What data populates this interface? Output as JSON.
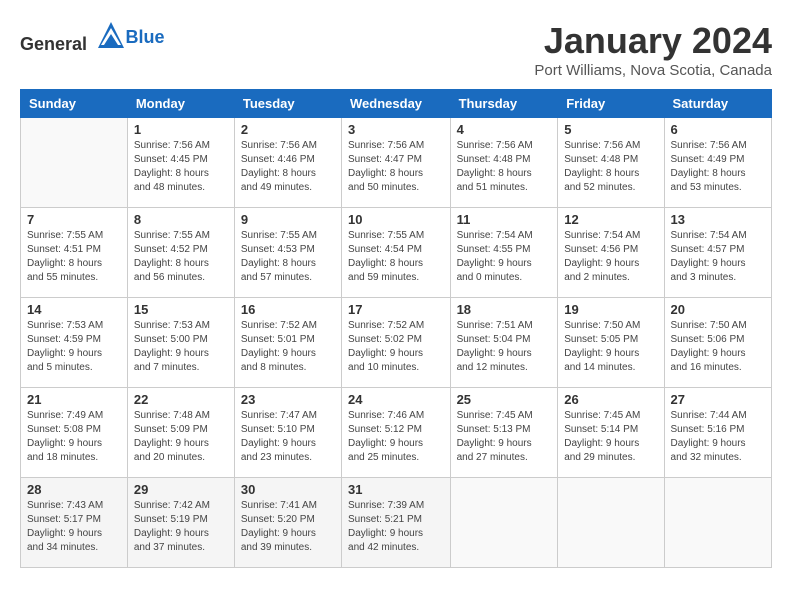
{
  "logo": {
    "text_general": "General",
    "text_blue": "Blue"
  },
  "title": "January 2024",
  "location": "Port Williams, Nova Scotia, Canada",
  "days_of_week": [
    "Sunday",
    "Monday",
    "Tuesday",
    "Wednesday",
    "Thursday",
    "Friday",
    "Saturday"
  ],
  "weeks": [
    [
      {
        "day": "",
        "info": ""
      },
      {
        "day": "1",
        "info": "Sunrise: 7:56 AM\nSunset: 4:45 PM\nDaylight: 8 hours\nand 48 minutes."
      },
      {
        "day": "2",
        "info": "Sunrise: 7:56 AM\nSunset: 4:46 PM\nDaylight: 8 hours\nand 49 minutes."
      },
      {
        "day": "3",
        "info": "Sunrise: 7:56 AM\nSunset: 4:47 PM\nDaylight: 8 hours\nand 50 minutes."
      },
      {
        "day": "4",
        "info": "Sunrise: 7:56 AM\nSunset: 4:48 PM\nDaylight: 8 hours\nand 51 minutes."
      },
      {
        "day": "5",
        "info": "Sunrise: 7:56 AM\nSunset: 4:48 PM\nDaylight: 8 hours\nand 52 minutes."
      },
      {
        "day": "6",
        "info": "Sunrise: 7:56 AM\nSunset: 4:49 PM\nDaylight: 8 hours\nand 53 minutes."
      }
    ],
    [
      {
        "day": "7",
        "info": "Sunrise: 7:55 AM\nSunset: 4:51 PM\nDaylight: 8 hours\nand 55 minutes."
      },
      {
        "day": "8",
        "info": "Sunrise: 7:55 AM\nSunset: 4:52 PM\nDaylight: 8 hours\nand 56 minutes."
      },
      {
        "day": "9",
        "info": "Sunrise: 7:55 AM\nSunset: 4:53 PM\nDaylight: 8 hours\nand 57 minutes."
      },
      {
        "day": "10",
        "info": "Sunrise: 7:55 AM\nSunset: 4:54 PM\nDaylight: 8 hours\nand 59 minutes."
      },
      {
        "day": "11",
        "info": "Sunrise: 7:54 AM\nSunset: 4:55 PM\nDaylight: 9 hours\nand 0 minutes."
      },
      {
        "day": "12",
        "info": "Sunrise: 7:54 AM\nSunset: 4:56 PM\nDaylight: 9 hours\nand 2 minutes."
      },
      {
        "day": "13",
        "info": "Sunrise: 7:54 AM\nSunset: 4:57 PM\nDaylight: 9 hours\nand 3 minutes."
      }
    ],
    [
      {
        "day": "14",
        "info": "Sunrise: 7:53 AM\nSunset: 4:59 PM\nDaylight: 9 hours\nand 5 minutes."
      },
      {
        "day": "15",
        "info": "Sunrise: 7:53 AM\nSunset: 5:00 PM\nDaylight: 9 hours\nand 7 minutes."
      },
      {
        "day": "16",
        "info": "Sunrise: 7:52 AM\nSunset: 5:01 PM\nDaylight: 9 hours\nand 8 minutes."
      },
      {
        "day": "17",
        "info": "Sunrise: 7:52 AM\nSunset: 5:02 PM\nDaylight: 9 hours\nand 10 minutes."
      },
      {
        "day": "18",
        "info": "Sunrise: 7:51 AM\nSunset: 5:04 PM\nDaylight: 9 hours\nand 12 minutes."
      },
      {
        "day": "19",
        "info": "Sunrise: 7:50 AM\nSunset: 5:05 PM\nDaylight: 9 hours\nand 14 minutes."
      },
      {
        "day": "20",
        "info": "Sunrise: 7:50 AM\nSunset: 5:06 PM\nDaylight: 9 hours\nand 16 minutes."
      }
    ],
    [
      {
        "day": "21",
        "info": "Sunrise: 7:49 AM\nSunset: 5:08 PM\nDaylight: 9 hours\nand 18 minutes."
      },
      {
        "day": "22",
        "info": "Sunrise: 7:48 AM\nSunset: 5:09 PM\nDaylight: 9 hours\nand 20 minutes."
      },
      {
        "day": "23",
        "info": "Sunrise: 7:47 AM\nSunset: 5:10 PM\nDaylight: 9 hours\nand 23 minutes."
      },
      {
        "day": "24",
        "info": "Sunrise: 7:46 AM\nSunset: 5:12 PM\nDaylight: 9 hours\nand 25 minutes."
      },
      {
        "day": "25",
        "info": "Sunrise: 7:45 AM\nSunset: 5:13 PM\nDaylight: 9 hours\nand 27 minutes."
      },
      {
        "day": "26",
        "info": "Sunrise: 7:45 AM\nSunset: 5:14 PM\nDaylight: 9 hours\nand 29 minutes."
      },
      {
        "day": "27",
        "info": "Sunrise: 7:44 AM\nSunset: 5:16 PM\nDaylight: 9 hours\nand 32 minutes."
      }
    ],
    [
      {
        "day": "28",
        "info": "Sunrise: 7:43 AM\nSunset: 5:17 PM\nDaylight: 9 hours\nand 34 minutes."
      },
      {
        "day": "29",
        "info": "Sunrise: 7:42 AM\nSunset: 5:19 PM\nDaylight: 9 hours\nand 37 minutes."
      },
      {
        "day": "30",
        "info": "Sunrise: 7:41 AM\nSunset: 5:20 PM\nDaylight: 9 hours\nand 39 minutes."
      },
      {
        "day": "31",
        "info": "Sunrise: 7:39 AM\nSunset: 5:21 PM\nDaylight: 9 hours\nand 42 minutes."
      },
      {
        "day": "",
        "info": ""
      },
      {
        "day": "",
        "info": ""
      },
      {
        "day": "",
        "info": ""
      }
    ]
  ]
}
